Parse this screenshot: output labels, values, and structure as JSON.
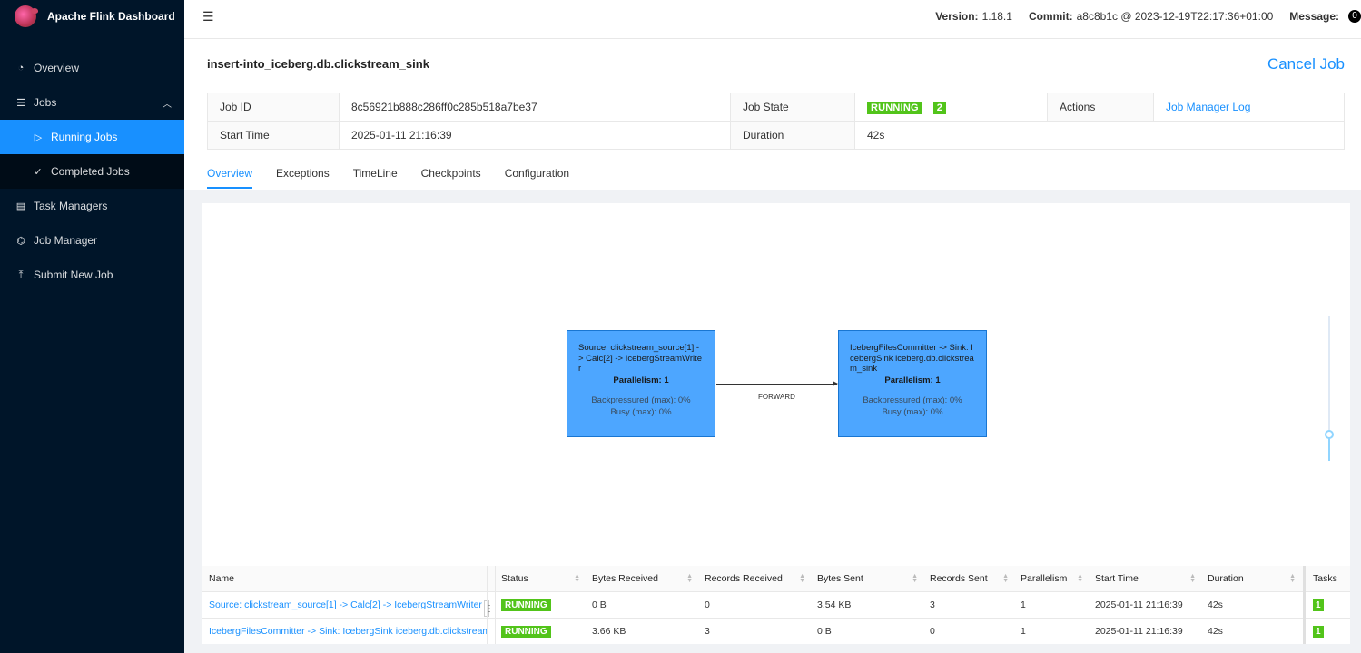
{
  "app": {
    "title": "Apache Flink Dashboard"
  },
  "sidebar": {
    "items": [
      {
        "label": "Overview",
        "icon": "dashboard-icon"
      },
      {
        "label": "Jobs",
        "icon": "list-icon"
      },
      {
        "label": "Running Jobs",
        "icon": "play-circle-icon"
      },
      {
        "label": "Completed Jobs",
        "icon": "check-circle-icon"
      },
      {
        "label": "Task Managers",
        "icon": "server-icon"
      },
      {
        "label": "Job Manager",
        "icon": "cluster-icon"
      },
      {
        "label": "Submit New Job",
        "icon": "upload-icon"
      }
    ]
  },
  "header": {
    "version_label": "Version:",
    "version": "1.18.1",
    "commit_label": "Commit:",
    "commit": "a8c8b1c @ 2023-12-19T22:17:36+01:00",
    "message_label": "Message:",
    "message_count": "0"
  },
  "job": {
    "title": "insert-into_iceberg.db.clickstream_sink",
    "cancel_label": "Cancel Job",
    "id_label": "Job ID",
    "id": "8c56921b888c286ff0c285b518a7be37",
    "state_label": "Job State",
    "state": "RUNNING",
    "state_count": "2",
    "actions_label": "Actions",
    "actions_link": "Job Manager Log",
    "start_label": "Start Time",
    "start": "2025-01-11 21:16:39",
    "duration_label": "Duration",
    "duration": "42s"
  },
  "tabs": [
    "Overview",
    "Exceptions",
    "TimeLine",
    "Checkpoints",
    "Configuration"
  ],
  "graph": {
    "nodes": [
      {
        "name": "Source: clickstream_source[1] -> Calc[2] -> IcebergStreamWriter",
        "parallelism": "Parallelism: 1",
        "backpressured": "Backpressured (max): 0%",
        "busy": "Busy (max): 0%"
      },
      {
        "name": "IcebergFilesCommitter -> Sink: IcebergSink iceberg.db.clickstream_sink",
        "parallelism": "Parallelism: 1",
        "backpressured": "Backpressured (max): 0%",
        "busy": "Busy (max): 0%"
      }
    ],
    "edge_label": "FORWARD"
  },
  "vertices": {
    "columns": [
      "Name",
      "Status",
      "Bytes Received",
      "Records Received",
      "Bytes Sent",
      "Records Sent",
      "Parallelism",
      "Start Time",
      "Duration",
      "Tasks"
    ],
    "rows": [
      {
        "name": "Source: clickstream_source[1] -> Calc[2] -> IcebergStreamWriter",
        "status": "RUNNING",
        "bytes_received": "0 B",
        "records_received": "0",
        "bytes_sent": "3.54 KB",
        "records_sent": "3",
        "parallelism": "1",
        "start": "2025-01-11 21:16:39",
        "duration": "42s",
        "tasks": "1"
      },
      {
        "name": "IcebergFilesCommitter -> Sink: IcebergSink iceberg.db.clickstream...",
        "status": "RUNNING",
        "bytes_received": "3.66 KB",
        "records_received": "3",
        "bytes_sent": "0 B",
        "records_sent": "0",
        "parallelism": "1",
        "start": "2025-01-11 21:16:39",
        "duration": "42s",
        "tasks": "1"
      }
    ]
  },
  "colors": {
    "sidebar": "#001529",
    "accent": "#1890ff",
    "running": "#52c41a",
    "node": "#4da6ff"
  }
}
